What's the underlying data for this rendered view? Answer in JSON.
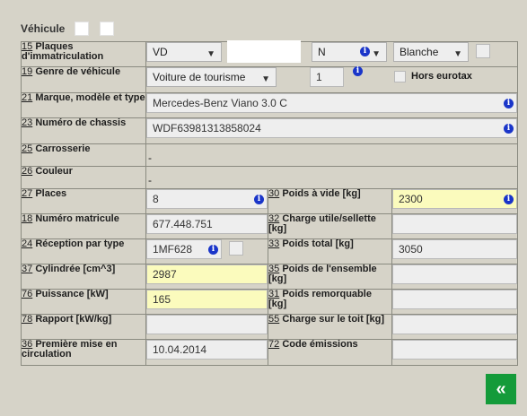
{
  "header": {
    "title": "Véhicule"
  },
  "rows": {
    "plaques": {
      "num": "15",
      "label": "Plaques d'immatriculation",
      "canton": "VD",
      "plate_number": "",
      "type": "N",
      "color": "Blanche"
    },
    "genre": {
      "num": "19",
      "label": "Genre de véhicule",
      "value": "Voiture de tourisme",
      "qty": "1",
      "hors_eurotax": "Hors eurotax"
    },
    "marque": {
      "num": "21",
      "label": "Marque, modèle et type",
      "value": "Mercedes-Benz Viano 3.0 C"
    },
    "chassis": {
      "num": "23",
      "label": "Numéro de chassis",
      "value": "WDF63981313858024"
    },
    "carrosserie": {
      "num": "25",
      "label": "Carrosserie",
      "value": "-"
    },
    "couleur": {
      "num": "26",
      "label": "Couleur",
      "value": "-"
    },
    "places": {
      "num": "27",
      "label": "Places",
      "value": "8"
    },
    "poids_vide": {
      "num": "30",
      "label": "Poids à vide [kg]",
      "value": "2300"
    },
    "matricule": {
      "num": "18",
      "label": "Numéro matricule",
      "value": "677.448.751"
    },
    "charge_utile": {
      "num": "32",
      "label": "Charge utile/sellette [kg]",
      "value": ""
    },
    "reception": {
      "num": "24",
      "label": "Réception par type",
      "value": "1MF628"
    },
    "poids_total": {
      "num": "33",
      "label": "Poids total [kg]",
      "value": "3050"
    },
    "cylindree": {
      "num": "37",
      "label": "Cylindrée [cm^3]",
      "value": "2987"
    },
    "poids_ensemble": {
      "num": "35",
      "label": "Poids de l'ensemble [kg]",
      "value": ""
    },
    "puissance": {
      "num": "76",
      "label": "Puissance [kW]",
      "value": "165"
    },
    "poids_remorquable": {
      "num": "31",
      "label": "Poids remorquable [kg]",
      "value": ""
    },
    "rapport": {
      "num": "78",
      "label": "Rapport [kW/kg]",
      "value": ""
    },
    "charge_toit": {
      "num": "55",
      "label": "Charge sur le toit [kg]",
      "value": ""
    },
    "premiere_mise": {
      "num": "36",
      "label": "Première mise en circulation",
      "value": "10.04.2014"
    },
    "code_emissions": {
      "num": "72",
      "label": "Code émissions",
      "value": ""
    }
  },
  "back_button": {
    "label": "«"
  },
  "colors": {
    "background": "#d6d3c8",
    "highlight": "#fbfbbd",
    "info": "#1a35c9",
    "button": "#149b3a"
  }
}
